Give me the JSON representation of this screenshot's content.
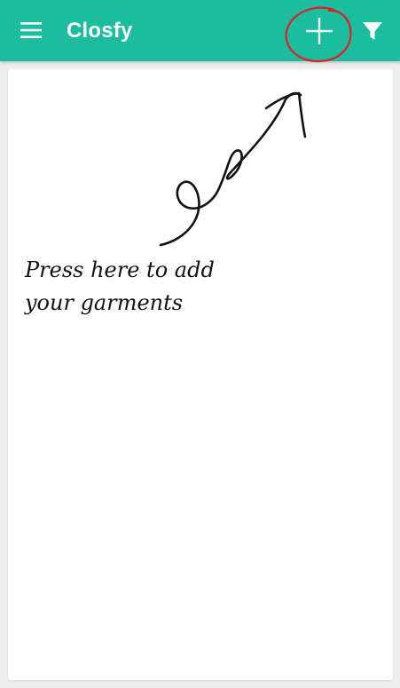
{
  "app_bar": {
    "title": "Closfy",
    "background_color": "#1bbc9f",
    "menu_icon": "menu-icon",
    "add_icon": "plus-icon",
    "filter_icon": "filter-icon"
  },
  "annotation": {
    "hint_lines": [
      "Press here to add",
      "your garments"
    ],
    "circle_color": "#e02020"
  },
  "content": {
    "background_color": "#ffffff"
  }
}
